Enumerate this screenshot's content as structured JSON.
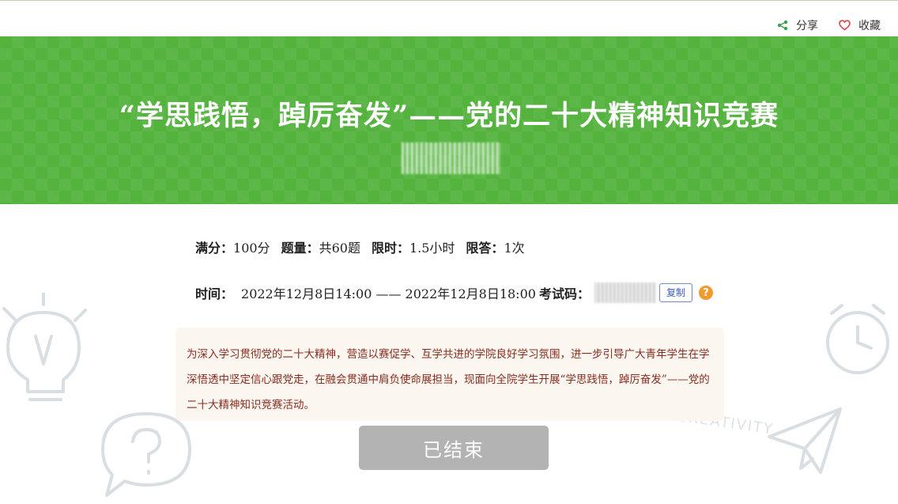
{
  "header": {
    "share_label": "分享",
    "favorite_label": "收藏",
    "share_icon": "share-icon",
    "favorite_icon": "heart-icon"
  },
  "banner": {
    "title": "“学思践悟，踔厉奋发”——党的二十大精神知识竞赛",
    "color": "#53b33d"
  },
  "info": {
    "score_label": "满分：",
    "score_value": "100分",
    "count_label": "题量：",
    "count_value": "共60题",
    "limit_label": "限时：",
    "limit_value": "1.5小时",
    "attempts_label": "限答：",
    "attempts_value": "1次",
    "time_label": "时间：",
    "time_value": "2022年12月8日14:00 —— 2022年12月8日18:00",
    "code_label": "考试码：",
    "copy_label": "复制",
    "help_icon": "help-icon"
  },
  "description": "为深入学习贯彻党的二十大精神，营造以赛促学、互学共进的学院良好学习氛围，进一步引导广大青年学生在学深悟透中坚定信心跟党走，在融会贯通中肩负使命展担当，现面向全院学生开展“学思践悟，踔厉奋发”——党的二十大精神知识竞赛活动。",
  "status_button": {
    "label": "已结束",
    "color": "#b3b3b3"
  },
  "decor": {
    "creativity_text": "CREATIVITY"
  }
}
